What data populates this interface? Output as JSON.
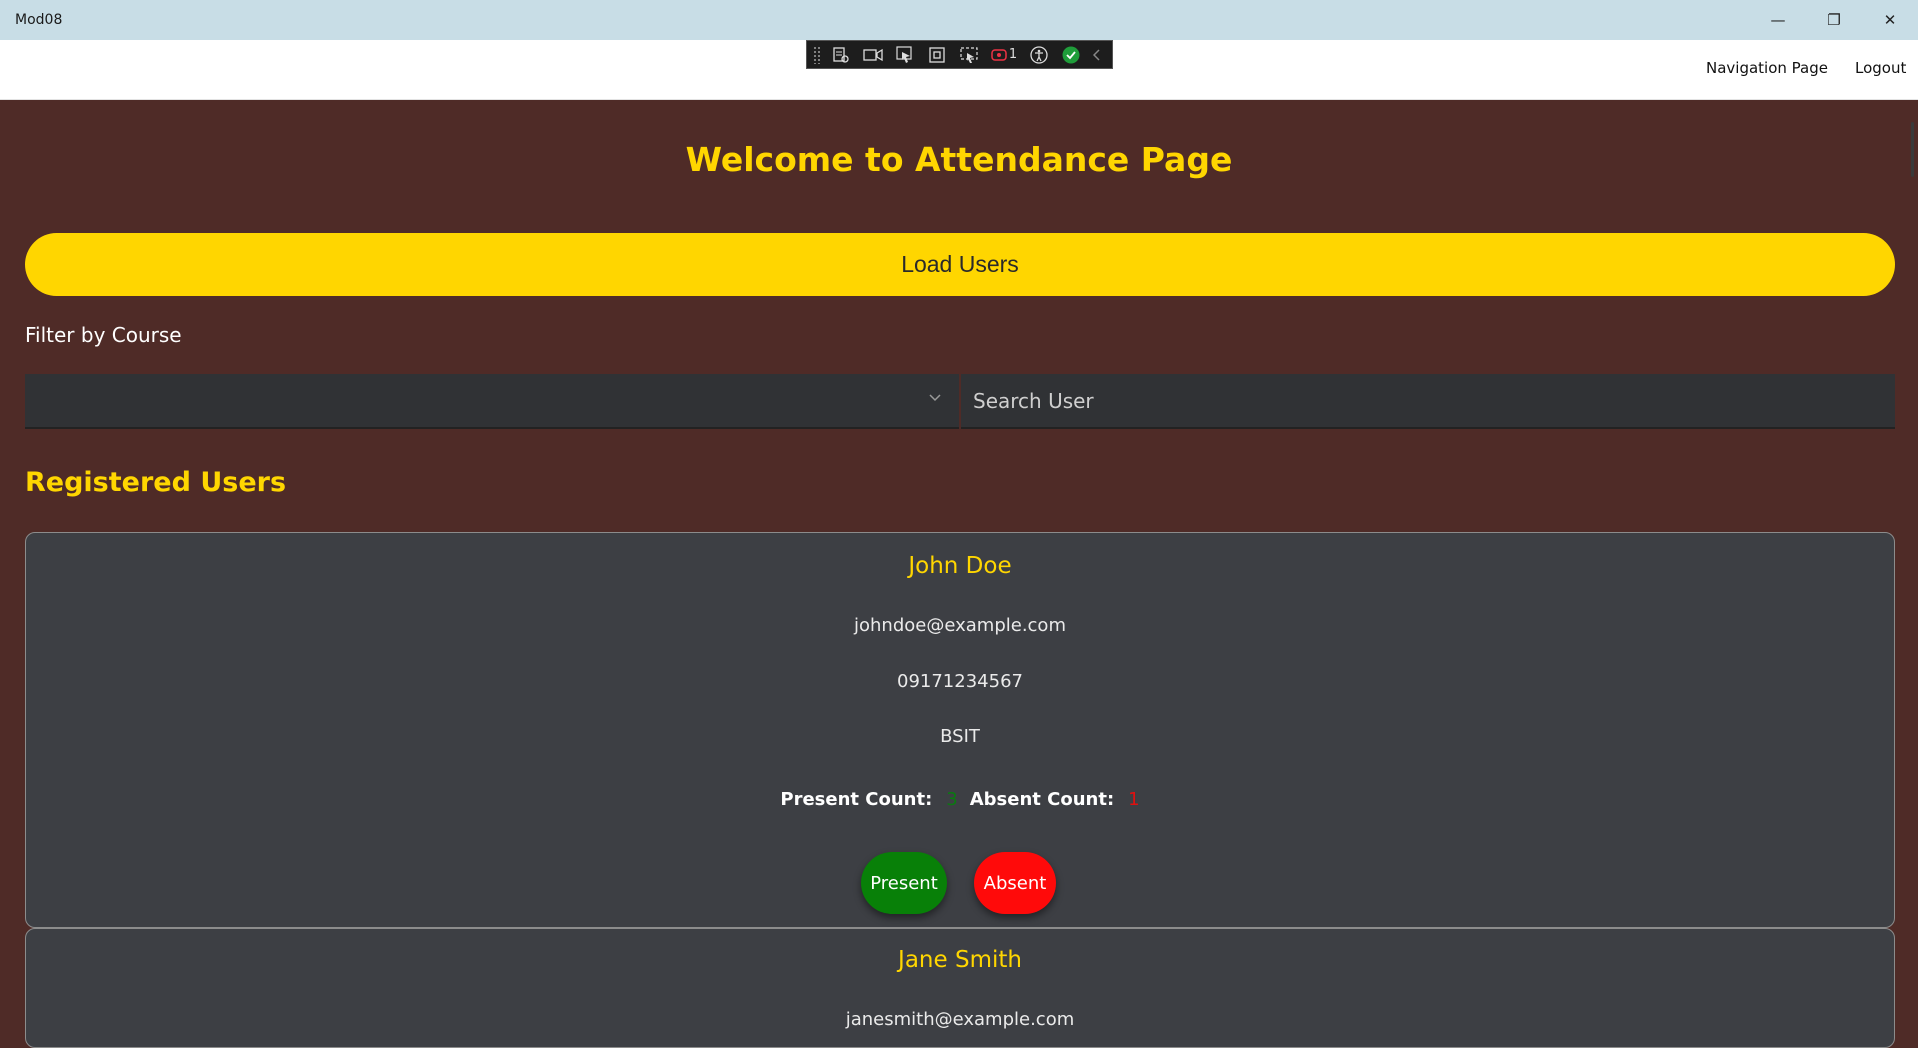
{
  "window": {
    "title": "Mod08",
    "minimize": "—",
    "restore": "❐",
    "close": "✕"
  },
  "appbar": {
    "nav_link": "Navigation Page",
    "logout_link": "Logout"
  },
  "devtools": {
    "badge_count": "1"
  },
  "page": {
    "title": "Welcome to Attendance Page",
    "load_button": "Load Users",
    "filter_label": "Filter by Course",
    "course_selected": "",
    "search_placeholder": "Search User",
    "section_title": "Registered Users"
  },
  "users": [
    {
      "name": "John Doe",
      "email": "johndoe@example.com",
      "phone": "09171234567",
      "course": "BSIT",
      "present_label": "Present Count:",
      "present_count": "3",
      "absent_label": "Absent Count:",
      "absent_count": "1",
      "present_button": "Present",
      "absent_button": "Absent"
    },
    {
      "name": "Jane Smith",
      "email": "janesmith@example.com"
    }
  ],
  "colors": {
    "background": "#4f2b27",
    "accent": "#ffd600",
    "card": "#3d3f44",
    "present": "#088008",
    "absent": "#ff0a0a"
  }
}
